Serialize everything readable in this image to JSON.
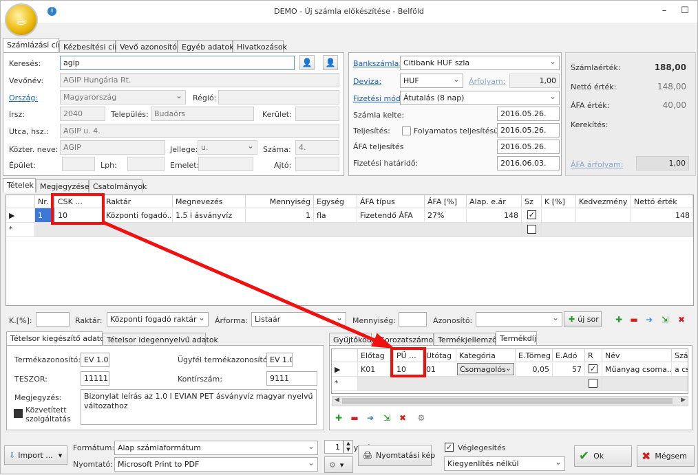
{
  "window": {
    "title": "DEMO - Új számla előkészítése - Belföld",
    "logo_icon": "coffee-logo-icon"
  },
  "top_tabs": [
    "Számlázási cím",
    "Kézbesítési cím",
    "Vevő azonosítók",
    "Egyéb adatok",
    "Hivatkozások"
  ],
  "customer": {
    "search_label": "Keresés:",
    "search_value": "agip",
    "name_label": "Vevőnév:",
    "name_value": "AGIP Hungária Rt.",
    "country_label": "Ország:",
    "country_value": "Magyarország",
    "region_label": "Régió:",
    "zip_label": "Irsz:",
    "zip_value": "2040",
    "city_label": "Település:",
    "city_value": "Budaörs",
    "district_label": "Kerület:",
    "street_label": "Utca, hsz.:",
    "street_value": "AGIP u. 4.",
    "pubname_label": "Közter. neve:",
    "pubname_value": "AGIP",
    "type_label": "Jellege:",
    "type_value": "u.",
    "number_label": "Száma:",
    "number_value": "4.",
    "building_label": "Épület:",
    "stair_label": "Lph:",
    "floor_label": "Emelet:",
    "door_label": "Ajtó:"
  },
  "invoice": {
    "bank_label": "Bankszámla:",
    "bank_value": "Citibank HUF szla",
    "currency_label": "Deviza:",
    "currency_value": "HUF",
    "rate_label": "Árfolyam:",
    "rate_value": "1,00",
    "payment_label": "Fizetési mód:",
    "payment_value": "Átutalás (8 nap)",
    "date_label": "Számla kelte:",
    "date_value": "2016.05.26.",
    "perf_label": "Teljesítés:",
    "cont_label": "Folyamatos teljesítésű",
    "perf_value": "2016.05.26.",
    "vatperf_label": "ÁFA teljesítés",
    "vatperf_value": "2016.05.26.",
    "due_label": "Fizetési határidő:",
    "due_value": "2016.06.03."
  },
  "totals": {
    "invoice_label": "Számlaérték:",
    "invoice_value": "188,00",
    "net_label": "Nettó érték:",
    "net_value": "148,00",
    "vat_label": "ÁFA érték:",
    "vat_value": "40,00",
    "round_label": "Kerekítés:",
    "vatrate_label": "ÁFA árfolyam:",
    "vatrate_value": "1,00"
  },
  "mid_tabs": [
    "Tételek",
    "Megjegyzések",
    "Csatolmányok"
  ],
  "items_grid": {
    "columns": [
      "Nr.",
      "CSK ...",
      "Raktár",
      "Megnevezés",
      "Mennyiség",
      "Egység",
      "ÁFA típus",
      "ÁFA [%]",
      "Alap. e.ár",
      "Sz",
      "K [%]",
      "Kedvezmény",
      "Nettó érték"
    ],
    "row": {
      "nr": "1",
      "csk": "10",
      "warehouse": "Központi fogadó...",
      "name": "1.5 l ásványvíz",
      "qty": "1",
      "unit": "fla",
      "vat_type": "Fizetendő ÁFA",
      "vat_pct": "27%",
      "price": "148",
      "net": "148"
    },
    "new_row_marker": "*"
  },
  "entry_bar": {
    "k_label": "K.[%]:",
    "wh_label": "Raktár:",
    "wh_value": "Központi fogadó raktár",
    "price_label": "Árforma:",
    "price_value": "Listaár",
    "qty_label": "Mennyiség:",
    "id_label": "Azonosító:",
    "new_row_btn": "új sor"
  },
  "left_tabs": [
    "Tételsor kiegészítő adatok",
    "Tételsor idegennyelvű adatok"
  ],
  "item_extra": {
    "prodid_label": "Termékazonosító:",
    "prodid_value": "EV 1.0",
    "custprod_label": "Ügyfél termékazonosító:",
    "custprod_value": "EV 1.0",
    "teszor_label": "TESZOR:",
    "teszor_value": "11111",
    "quota_label": "Kontírszám:",
    "quota_value": "9111",
    "note_label": "Megjegyzés:",
    "note_value": "Bizonylat leírás az 1.0 l EVIAN PET ásványvíz magyar nyelvű változathoz",
    "mediated_label": "Közvetített szolgáltatás"
  },
  "right_tabs": [
    "Gyűjtőkódok",
    "Sorozatszámok",
    "Termékjellemzők",
    "Termékdíj"
  ],
  "fee_grid": {
    "columns": [
      "Előtag",
      "PÜ ...",
      "Utótag",
      "Kategória",
      "E.Tömeg",
      "E.Adó",
      "R",
      "Név",
      "Szá"
    ],
    "row": {
      "prefix": "K01",
      "pu": "10",
      "suffix": "01",
      "category": "Csomagolós",
      "weight": "0,05",
      "tax": "57",
      "name": "Műanyag csoma...",
      "sza": "a cs"
    }
  },
  "bottom": {
    "import_btn": "Import ...",
    "format_label": "Formátum:",
    "format_value": "Alap számlaformátum",
    "printer_label": "Nyomtató:",
    "printer_value": "Microsoft Print to PDF",
    "copies_label": "Példányszám:",
    "copies_value": "1",
    "print_btn": "Nyomtatási kép",
    "final_label": "Véglegesítés",
    "settle_value": "Kiegyenlítés nélkül",
    "ok_btn": "Ok",
    "cancel_btn": "Mégsem"
  }
}
